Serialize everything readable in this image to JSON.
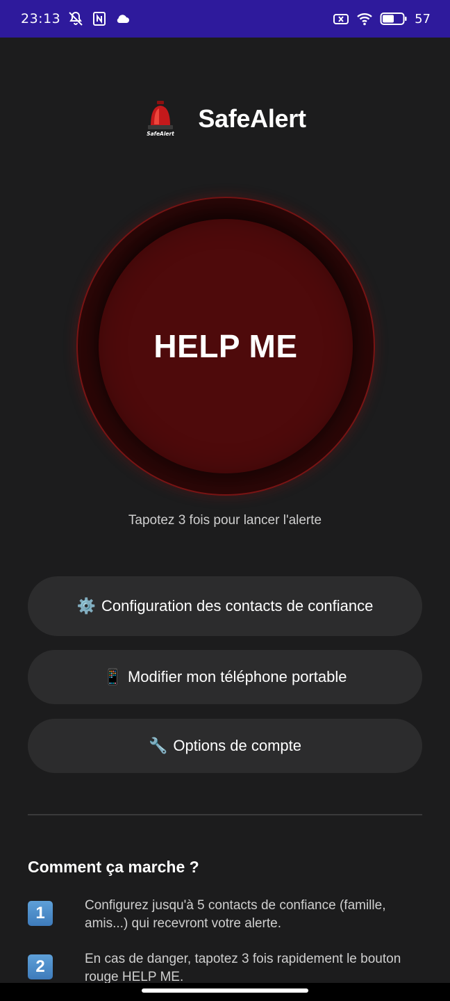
{
  "status_bar": {
    "time": "23:13",
    "battery_percent": "57",
    "battery_level": 0.57,
    "icons": [
      "mute-icon",
      "nfc-icon",
      "cloud-icon",
      "sim-off-icon",
      "wifi-icon",
      "battery-icon"
    ]
  },
  "header": {
    "logo_text": "SafeAlert",
    "title": "SafeAlert"
  },
  "help_button": {
    "label": "HELP ME",
    "color": "#4e0a0b"
  },
  "hint": "Tapotez 3 fois pour lancer l'alerte",
  "buttons": [
    {
      "emoji": "⚙️",
      "label": "Configuration des contacts de confiance"
    },
    {
      "emoji": "📱",
      "label": "Modifier mon téléphone portable"
    },
    {
      "emoji": "🔧",
      "label": "Options de compte"
    }
  ],
  "how_it_works": {
    "title": "Comment ça marche ?",
    "steps": [
      {
        "number": "1",
        "text": "Configurez jusqu'à 5 contacts de confiance (famille, amis...) qui recevront votre alerte."
      },
      {
        "number": "2",
        "text": "En cas de danger, tapotez 3 fois rapidement le bouton rouge HELP ME."
      }
    ]
  },
  "colors": {
    "status_bar": "#2e1a9c",
    "background": "#1c1c1d",
    "button_bg": "#2c2c2d",
    "accent_red": "#7a1515"
  }
}
